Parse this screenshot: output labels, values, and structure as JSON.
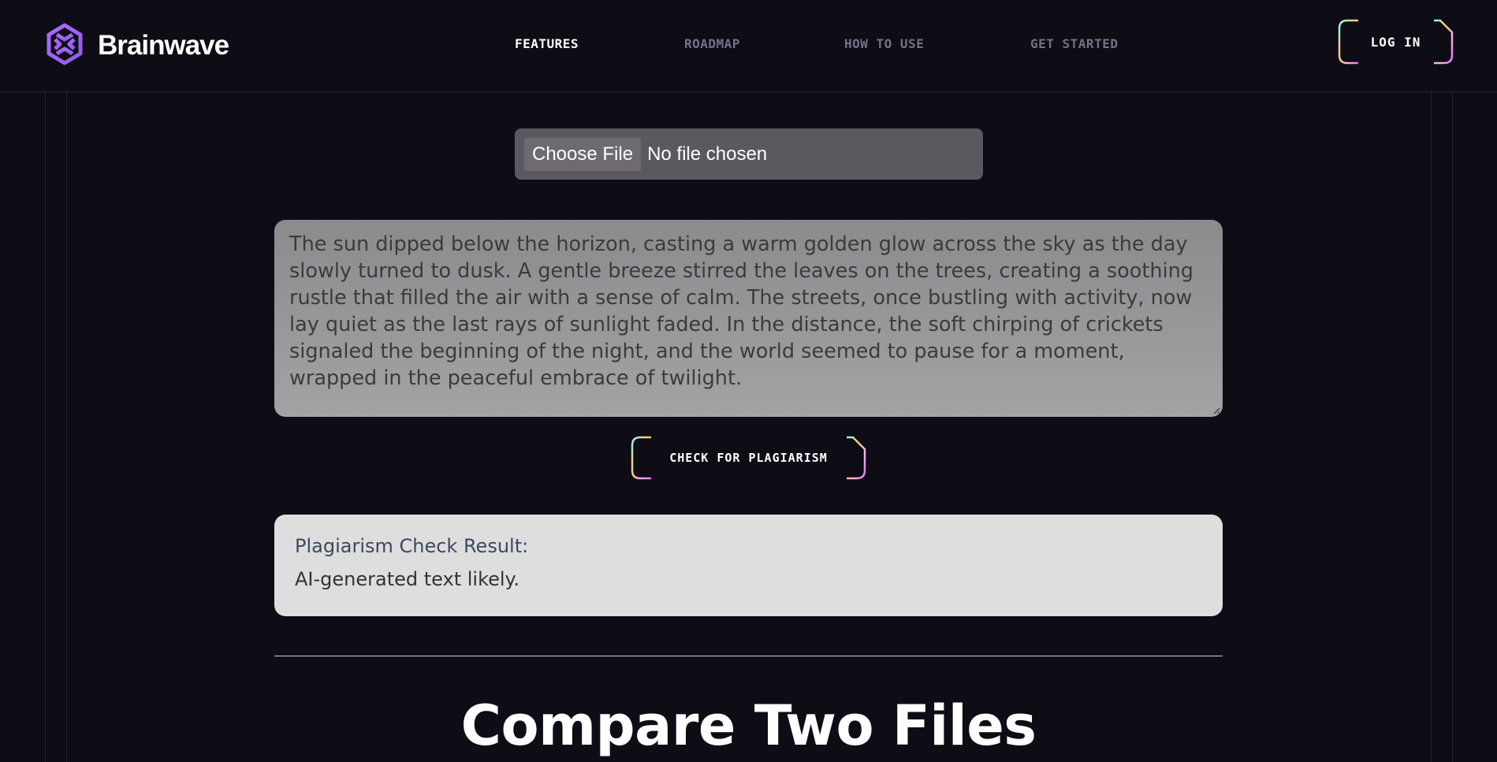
{
  "brand": {
    "name": "Brainwave",
    "logo_icon": "brainwave-logo-icon"
  },
  "nav": {
    "items": [
      {
        "label": "FEATURES",
        "active": true
      },
      {
        "label": "ROADMAP",
        "active": false
      },
      {
        "label": "HOW TO USE",
        "active": false
      },
      {
        "label": "GET STARTED",
        "active": false
      }
    ],
    "login_label": "LOG IN"
  },
  "upload": {
    "button_label": "Choose File",
    "status": "No file chosen"
  },
  "input_text": "The sun dipped below the horizon, casting a warm golden glow across the sky as the day slowly turned to dusk. A gentle breeze stirred the leaves on the trees, creating a soothing rustle that filled the air with a sense of calm. The streets, once bustling with activity, now lay quiet as the last rays of sunlight faded. In the distance, the soft chirping of crickets signaled the beginning of the night, and the world seemed to pause for a moment, wrapped in the peaceful embrace of twilight.",
  "check_button_label": "CHECK FOR PLAGIARISM",
  "result": {
    "title": "Plagiarism Check Result:",
    "text": "AI-generated text likely."
  },
  "compare_section": {
    "title": "Compare Two Files"
  },
  "colors": {
    "background": "#0e0c15",
    "accent_purple": "#ac6aff",
    "gradient": [
      "#89f9e8",
      "#facb7b",
      "#fface4",
      "#d87cee"
    ]
  }
}
